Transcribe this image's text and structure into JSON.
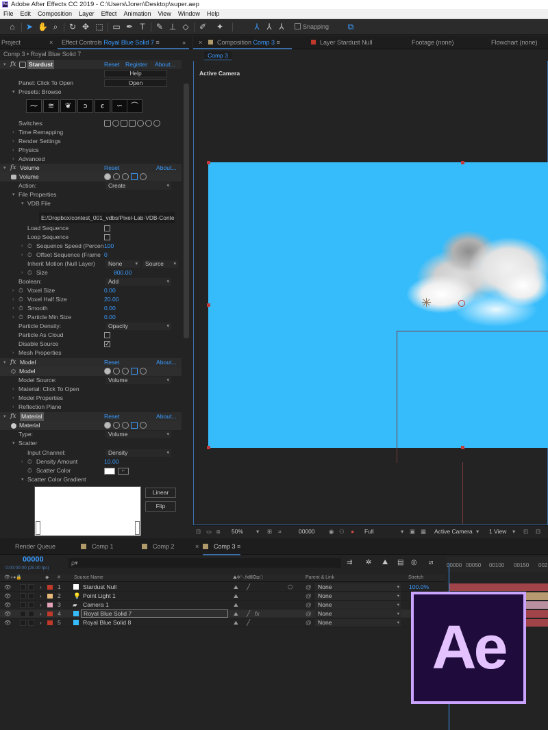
{
  "window": {
    "title": "Adobe After Effects CC 2019 - C:\\Users\\Joren\\Desktop\\super.aep",
    "app_icon": "Ae"
  },
  "menu": [
    "File",
    "Edit",
    "Composition",
    "Layer",
    "Effect",
    "Animation",
    "View",
    "Window",
    "Help"
  ],
  "toolbar": {
    "snapping_label": "Snapping"
  },
  "left_panel": {
    "tab_project": "Project",
    "tab_effect_controls": "Effect Controls",
    "tab_effect_controls_layer": "Royal Blue Solid 7",
    "comp_line": "Comp 3 • Royal Blue Solid 7",
    "stardust": {
      "name": "Stardust",
      "reset": "Reset",
      "register": "Register",
      "about": "About...",
      "help": "Help",
      "panel_label": "Panel: Click To Open",
      "open": "Open",
      "presets_label": "Presets: Browse",
      "switches_label": "Switches:",
      "time_remapping": "Time Remapping",
      "render_settings": "Render Settings",
      "physics": "Physics",
      "advanced": "Advanced"
    },
    "volume": {
      "name": "Volume",
      "reset": "Reset",
      "about": "About...",
      "sub": "Volume",
      "action_label": "Action:",
      "action_value": "Create",
      "file_properties": "File Properties",
      "vdb_file": "VDB File",
      "vdb_path": "E:/Dropbox/contest_001_vdbs/Pixel-Lab-VDB-Conte",
      "load_sequence": "Load Sequence",
      "loop_sequence": "Loop Sequence",
      "sequence_speed": "Sequence Speed (Percen",
      "sequence_speed_value": "100",
      "offset_sequence": "Offset Sequence (Frame",
      "offset_sequence_value": "0",
      "inherit_motion": "Inherit Motion (Null Layer)",
      "inherit_value": "None",
      "inherit_value2": "Source",
      "size_label": "Size",
      "size_value": "800.00",
      "boolean_label": "Boolean:",
      "boolean_value": "Add",
      "voxel_size": "Voxel Size",
      "voxel_size_value": "0.00",
      "voxel_half_size": "Voxel Half Size",
      "voxel_half_size_value": "20.00",
      "smooth": "Smooth",
      "smooth_value": "0.00",
      "particle_min_size": "Particle Min Size",
      "particle_min_size_value": "0.00",
      "particle_density": "Particle Density:",
      "particle_density_value": "Opacity",
      "particle_as_cloud": "Particle As Cloud",
      "disable_source": "Disable Source",
      "mesh_properties": "Mesh Properties"
    },
    "model": {
      "name": "Model",
      "reset": "Reset",
      "about": "About...",
      "sub": "Model",
      "source_label": "Model Source:",
      "source_value": "Volume",
      "material_label": "Material: Click To Open",
      "model_properties": "Model Properties",
      "reflection_plane": "Reflection Plane"
    },
    "material": {
      "name": "Material",
      "reset": "Reset",
      "about": "About...",
      "sub": "Material",
      "type_label": "Type:",
      "type_value": "Volume",
      "scatter": "Scatter",
      "input_channel": "Input Channel:",
      "input_channel_value": "Density",
      "density_amount": "Density Amount",
      "density_amount_value": "10.00",
      "scatter_color": "Scatter Color",
      "scatter_gradient": "Scatter Color Gradient",
      "linear": "Linear",
      "flip": "Flip"
    }
  },
  "right_panel": {
    "tab_composition": "Composition",
    "tab_composition_name": "Comp 3",
    "tab_layer": "Layer",
    "tab_layer_name": "Stardust Null",
    "tab_footage": "Footage (none)",
    "tab_flowchart": "Flowchart (none)",
    "comp_pill": "Comp 3",
    "active_camera": "Active Camera",
    "viewbar": {
      "zoom": "50%",
      "timecode": "00000",
      "resolution": "Full",
      "camera": "Active Camera",
      "views": "1 View"
    }
  },
  "timeline": {
    "tabs": [
      "Render Queue",
      "Comp 1",
      "Comp 2",
      "Comp 3"
    ],
    "timecode": "00000",
    "timecode_sub": "0:00:00:00 (25.00 fps)",
    "search_placeholder": "ρ▾",
    "col_source": "Source Name",
    "col_parent": "Parent & Link",
    "col_stretch": "Stretch",
    "ruler": [
      "00000",
      "00050",
      "00100",
      "00150",
      "002"
    ],
    "layers": [
      {
        "num": "1",
        "name": "Stardust Null",
        "color": "#c0392b",
        "parent": "None",
        "stretch": "100.0%"
      },
      {
        "num": "2",
        "name": "Point Light 1",
        "color": "#e6b87a",
        "parent": "None",
        "stretch": ""
      },
      {
        "num": "3",
        "name": "Camera 1",
        "color": "#e2a2b8",
        "parent": "None",
        "stretch": ""
      },
      {
        "num": "4",
        "name": "Royal Blue Solid 7",
        "color": "#c0392b",
        "parent": "None",
        "stretch": ""
      },
      {
        "num": "5",
        "name": "Royal Blue Solid 8",
        "color": "#c0392b",
        "parent": "None",
        "stretch": ""
      }
    ]
  },
  "logo": {
    "text": "Ae"
  },
  "colors": {
    "accent": "#3a9bff",
    "sky": "#36bcfb",
    "logo_bg": "#1f0c3c",
    "logo_border": "#caa4ff"
  }
}
